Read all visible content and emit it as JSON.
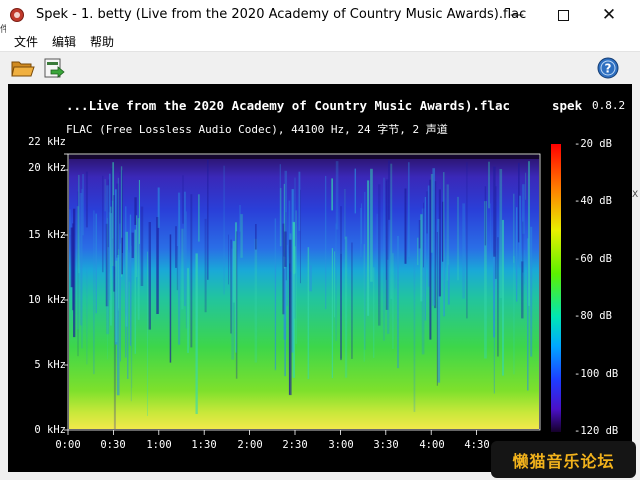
{
  "window": {
    "title": "Spek - 1. betty (Live from the 2020 Academy of Country Music Awards).flac",
    "minimize_icon": "minimize-icon",
    "maximize_icon": "maximize-icon",
    "close_icon": "close-icon"
  },
  "menu": {
    "items": [
      {
        "label": "文件"
      },
      {
        "label": "编辑"
      },
      {
        "label": "帮助"
      }
    ]
  },
  "toolbar": {
    "open_icon": "folder-open-icon",
    "save_icon": "save-export-icon",
    "help_icon": "help-icon"
  },
  "spectrogram": {
    "file_title": "...Live from the 2020 Academy of Country Music Awards).flac",
    "app_name": "spek",
    "app_version": "0.8.2",
    "file_info": "FLAC (Free Lossless Audio Codec), 44100 Hz, 24 字节, 2 声道",
    "y_axis_labels": [
      "22 kHz",
      "20 kHz",
      "15 kHz",
      "10 kHz",
      "5 kHz",
      "0 kHz"
    ],
    "x_axis_labels": [
      "0:00",
      "0:30",
      "1:00",
      "1:30",
      "2:00",
      "2:30",
      "3:00",
      "3:30",
      "4:00",
      "4:30"
    ],
    "db_labels": [
      "-20 dB",
      "-40 dB",
      "-60 dB",
      "-80 dB",
      "-100 dB",
      "-120 dB"
    ]
  },
  "colors": {
    "background": "#000000",
    "colormap": [
      "#ff0000",
      "#ff8000",
      "#ffff00",
      "#80ff00",
      "#00ff00",
      "#00ffff",
      "#0000ff",
      "#4000a0",
      "#1a0030"
    ]
  },
  "watermark": {
    "text": "懒猫音乐论坛"
  },
  "outside_fragments": {
    "left_edge": "件",
    "right_edge": "X"
  }
}
